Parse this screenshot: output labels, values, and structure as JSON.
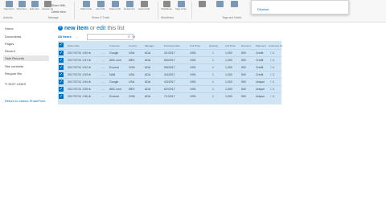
{
  "ribbon": {
    "buttons": [
      {
        "label": "New Item"
      },
      {
        "label": "View Item"
      },
      {
        "label": "Edit Item"
      },
      {
        "label": "Version History"
      },
      {
        "label": "Shared With"
      },
      {
        "label": "Delete Item"
      },
      {
        "label": "Attach File"
      },
      {
        "label": "Alert Me"
      },
      {
        "label": "Workflows"
      },
      {
        "label": "Approve/Reject"
      },
      {
        "label": "Tags & Notes"
      }
    ],
    "small_buttons": [
      "Share With",
      "Delete Item"
    ],
    "groups": [
      "Actions",
      "Manage",
      "Share & Track",
      "Workflows",
      "Tags and Notes"
    ]
  },
  "popup": {
    "link": "Dismiss"
  },
  "nav": {
    "items": [
      "Home",
      "Documents",
      "Pages",
      "Recent",
      "Sale Records",
      "Site contents",
      "Recycle Bin"
    ],
    "selected": "Sale Records",
    "edit_links": "EDIT LINKS",
    "return": "Return to classic SharePoint"
  },
  "list": {
    "new_item": "new item",
    "or": "or",
    "edit": "edit",
    "edit_end": "this list",
    "view": "All Items",
    "view_more": "...",
    "search_placeholder": "Find an item",
    "columns": [
      "Order Date",
      "Customer",
      "Country",
      "Manager",
      "Purchase Date",
      "Unit Price",
      "Quantity",
      "Unit Price",
      "Discount",
      "Shipment",
      "Customer Ad"
    ],
    "rows": [
      {
        "order_date": "2017/07/11 1:50 ⊕",
        "customer": "Google",
        "country": "USA",
        "manager": "ADA",
        "purchase_date": "3/1/2017",
        "unit_price": "1991",
        "quantity": "1",
        "unit_price2": "1,000",
        "discount": "500",
        "shipment": "Credit",
        "customer_ad": "□ 1"
      },
      {
        "order_date": "2017/07/11 1:51 ⊕",
        "customer": "ABC.com",
        "country": "MEX",
        "manager": "ADA",
        "purchase_date": "6/6/2017",
        "unit_price": "1991",
        "quantity": "1",
        "unit_price2": "1,000",
        "discount": "500",
        "shipment": "Credit",
        "customer_ad": "□ 1"
      },
      {
        "order_date": "2017/07/11 1:52 ⊕",
        "customer": "Ecomot",
        "country": "CHN",
        "manager": "ADA",
        "purchase_date": "5/5/2017",
        "unit_price": "1991",
        "quantity": "1",
        "unit_price2": "1,000",
        "discount": "500",
        "shipment": "Credit",
        "customer_ad": "□ 1"
      },
      {
        "order_date": "2017/07/11 1:53 ⊕",
        "customer": "NAB",
        "country": "USA",
        "manager": "ADA",
        "purchase_date": "4/4/2017",
        "unit_price": "1991",
        "quantity": "1",
        "unit_price2": "1,000",
        "discount": "500",
        "shipment": "Credit",
        "customer_ad": "□ 1"
      },
      {
        "order_date": "2017/07/11 1:54 ⊕",
        "customer": "Google",
        "country": "USA",
        "manager": "ADA",
        "purchase_date": "4/3/2017",
        "unit_price": "1991",
        "quantity": "1",
        "unit_price2": "1,000",
        "discount": "500",
        "shipment": "Unique",
        "customer_ad": "□ 1"
      },
      {
        "order_date": "2017/07/11 1:55 ⊕",
        "customer": "ABC.com",
        "country": "MEX",
        "manager": "ADA",
        "purchase_date": "6/2/2017",
        "unit_price": "1991",
        "quantity": "1",
        "unit_price2": "1,000",
        "discount": "500",
        "shipment": "Unique",
        "customer_ad": "□ 1"
      },
      {
        "order_date": "2017/07/11 1:56 ⊕",
        "customer": "Ecomot",
        "country": "CHN",
        "manager": "ADA",
        "purchase_date": "7/1/2017",
        "unit_price": "1991",
        "quantity": "1",
        "unit_price2": "1,000",
        "discount": "500",
        "shipment": "Unique",
        "customer_ad": "□ 1"
      }
    ]
  },
  "colors": {
    "accent": "#0072c6",
    "selection": "#cfe5f5",
    "ribbon": "#f7f7f7"
  }
}
